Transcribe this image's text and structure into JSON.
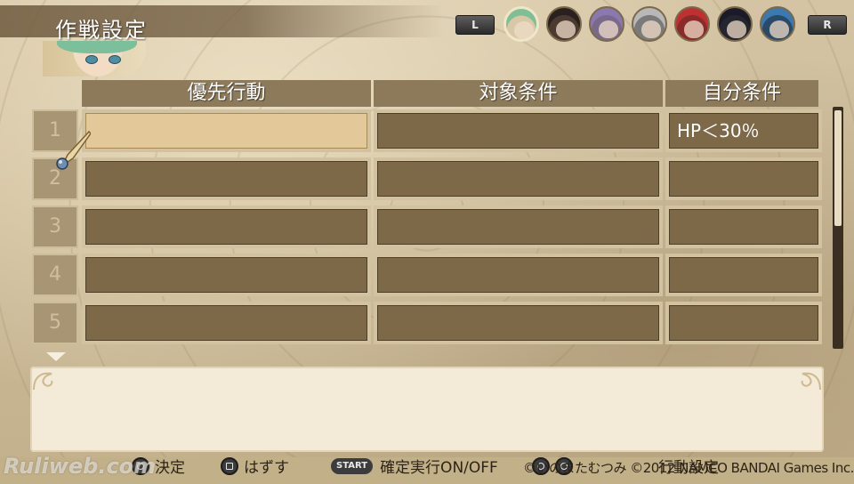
{
  "title": "作戦設定",
  "shoulder_left": "L",
  "shoulder_right": "R",
  "party": [
    {
      "icon": "character-portrait-green-hair",
      "color": "#d8c8a8",
      "hair": "#7fbf96"
    },
    {
      "icon": "character-portrait-dark-hair",
      "color": "#4a3a30",
      "hair": "#2a2020"
    },
    {
      "icon": "character-portrait-purple-hair",
      "color": "#7a6a8a",
      "hair": "#8c78b0"
    },
    {
      "icon": "character-portrait-silver-hair",
      "color": "#7a7a7a",
      "hair": "#b8b8b8"
    },
    {
      "icon": "character-portrait-red-hair",
      "color": "#8a2a2a",
      "hair": "#c03030"
    },
    {
      "icon": "character-portrait-black-hair",
      "color": "#252530",
      "hair": "#1a1a28"
    },
    {
      "icon": "character-portrait-blue-hair",
      "color": "#2a4a6a",
      "hair": "#3a7ab0"
    }
  ],
  "headers": {
    "action": "優先行動",
    "target": "対象条件",
    "self": "自分条件"
  },
  "rows": [
    {
      "num": "1",
      "action": "",
      "target": "",
      "self": "HP＜30％",
      "selected": true
    },
    {
      "num": "2",
      "action": "",
      "target": "",
      "self": ""
    },
    {
      "num": "3",
      "action": "",
      "target": "",
      "self": ""
    },
    {
      "num": "4",
      "action": "",
      "target": "",
      "self": ""
    },
    {
      "num": "5",
      "action": "",
      "target": "",
      "self": ""
    }
  ],
  "scroll_position": 0.0,
  "description": "",
  "help": {
    "confirm": "決定",
    "remove": "はずす",
    "start_button": "START",
    "toggle": "確定実行ON/OFF",
    "hidden_tail": "行動設定"
  },
  "copyright": "©いのまたむつみ ©2012 NAMCO BANDAI Games Inc.",
  "watermark": "Ruliweb.com",
  "colors": {
    "panel": "#7d6848",
    "selected_cell": "#e3c99a",
    "header": "#8c7a5b",
    "background": "#c9b896"
  }
}
